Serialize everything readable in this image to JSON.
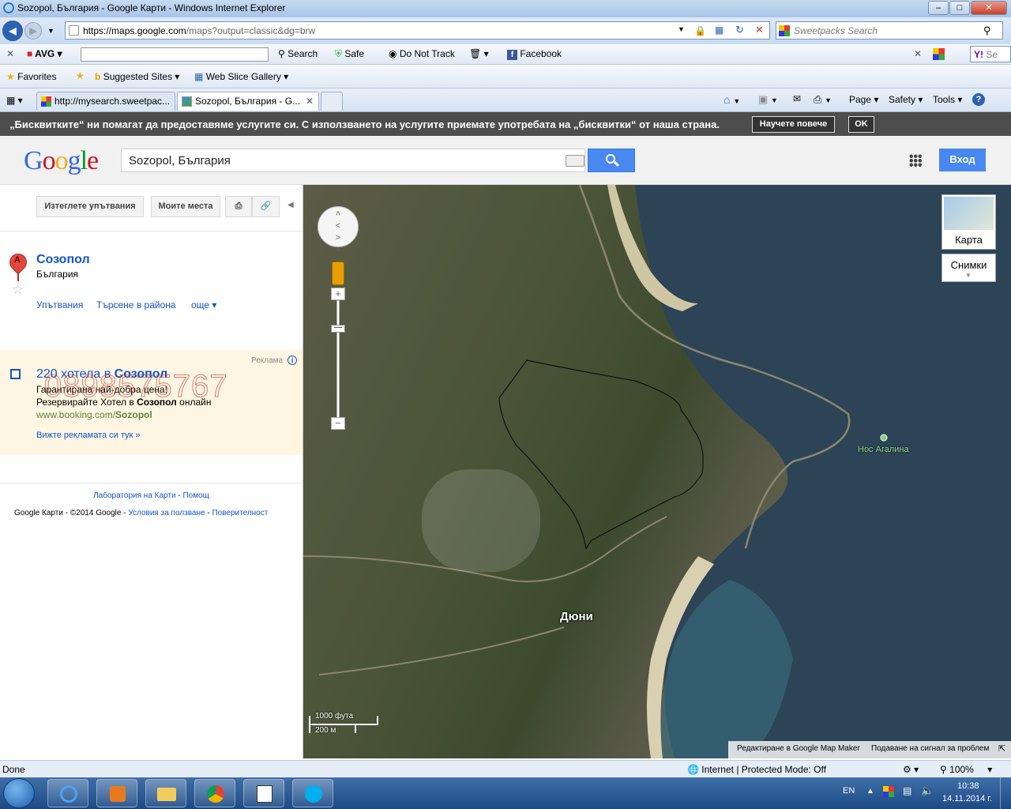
{
  "window": {
    "title": "Sozopol, България - Google Карти - Windows Internet Explorer",
    "controls": [
      "–",
      "□",
      "✕"
    ]
  },
  "addressbar": {
    "url_main": "https://maps.google.com",
    "url_rest": "/maps?output=classic&dg=brw",
    "search_placeholder": "Sweetpacks Search"
  },
  "toolbar_avg": {
    "close": "✕",
    "logo": "AVG",
    "search": "Search",
    "safe": "Safe",
    "dnt": "Do Not Track",
    "facebook": "Facebook",
    "close2": "✕",
    "yahoo_short": "Se"
  },
  "favorites_bar": {
    "favorites": "Favorites",
    "suggested": "Suggested Sites ▾",
    "webslice": "Web Slice Gallery ▾"
  },
  "tabs": [
    {
      "label": "http://mysearch.sweetpac..."
    },
    {
      "label": "Sozopol, България - G...",
      "close": "✕"
    }
  ],
  "command_bar": {
    "page": "Page ▾",
    "safety": "Safety ▾",
    "tools": "Tools ▾",
    "help": "?"
  },
  "cookie_bar": {
    "message": "„Бисквитките“ ни помагат да предоставяме услугите си. С използването на услугите приемате употребата на „бисквитки“ от наша страна.",
    "learn_more": "Научете повече",
    "ok": "OK"
  },
  "google": {
    "logo_letters": [
      "G",
      "o",
      "o",
      "g",
      "l",
      "e"
    ],
    "logo_colors": [
      "#3369e8",
      "#d50f25",
      "#eeb211",
      "#3369e8",
      "#009925",
      "#d50f25"
    ],
    "search_value": "Sozopol, България",
    "signin": "Вход"
  },
  "left_panel": {
    "btn_directions": "Изтеглете упътвания",
    "btn_my_places": "Моите места",
    "place_marker": "A",
    "place_name": "Созопол",
    "place_country": "България",
    "star": "☆",
    "link_directions": "Упътвания",
    "link_nearby": "Търсене в района",
    "link_more": "още ▾",
    "ad_label": "Реклама",
    "ad_info": "i",
    "ad_title_pre": "220 хотела в ",
    "ad_title_bold": "Созопол",
    "ad_line1": "Гарантирана най-добра цена!",
    "ad_line2_pre": "Резервирайте Хотел в ",
    "ad_line2_bold": "Созопол",
    "ad_line2_post": " онлайн",
    "ad_url_pre": "www.booking.com/",
    "ad_url_bold": "Sozopol",
    "ad_more": "Вижте рекламата си тук »",
    "watermark": "0898575767",
    "footer_labs": "Лаборатория на Карти",
    "footer_sep": " - ",
    "footer_help": "Помощ",
    "footer_brand": "Google Карти",
    "footer_copy": " - ©2014 Google - ",
    "footer_terms": "Условия за ползване",
    "footer_sep2": " - ",
    "footer_privacy": "Поверителност"
  },
  "map": {
    "map_type_label": "Карта",
    "satellite_label": "Снимки",
    "zoom_plus": "+",
    "zoom_minus": "−",
    "label_dyuni": "Дюни",
    "label_cape": "Нос Агалина",
    "scale_ft": "1000 фута",
    "scale_m": "200 м",
    "edit_link": "Редактиране в Google Map Maker",
    "report_link": "Подаване на сигнал за проблем"
  },
  "statusbar": {
    "left": "Done",
    "zone": "Internet | Protected Mode: Off",
    "zoom": "100%"
  },
  "taskbar": {
    "lang": "EN",
    "time": "10:38",
    "date": "14.11.2014 г."
  }
}
